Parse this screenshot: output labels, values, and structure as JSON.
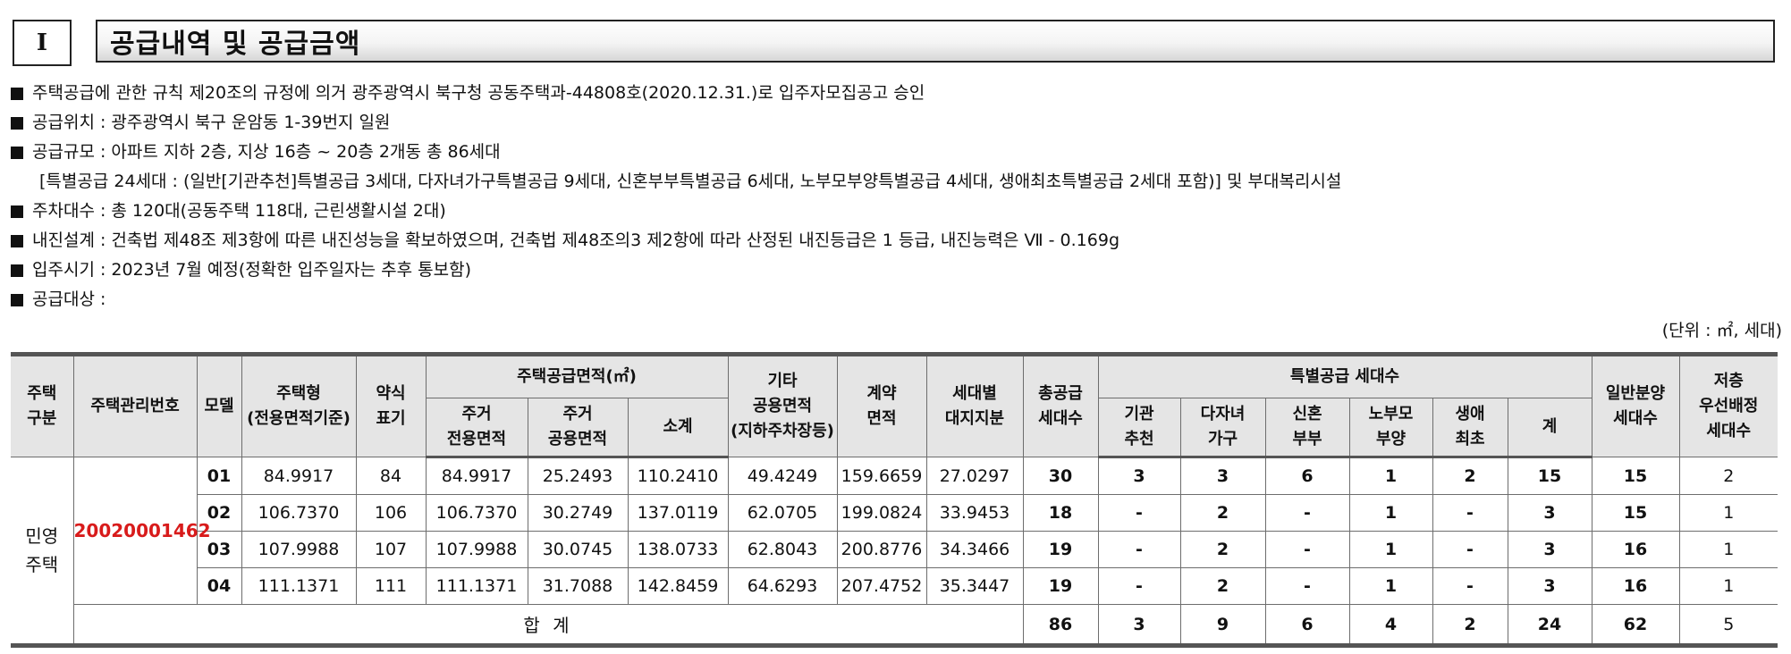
{
  "header": {
    "section_number": "I",
    "title": "공급내역 및 공급금액"
  },
  "bullets": [
    "주택공급에 관한 규칙 제20조의 규정에 의거 광주광역시 북구청 공동주택과-44808호(2020.12.31.)로 입주자모집공고 승인",
    "공급위치 : 광주광역시 북구 운암동 1-39번지 일원",
    "공급규모 : 아파트 지하 2층, 지상 16층 ~ 20층 2개동 총 86세대",
    "주차대수 : 총 120대(공동주택 118대, 근린생활시설 2대)",
    "내진설계 : 건축법 제48조 제3항에 따른 내진성능을 확보하였으며, 건축법 제48조의3 제2항에 따라 산정된 내진등급은 1 등급, 내진능력은 Ⅶ - 0.169g",
    "입주시기 : 2023년 7월 예정(정확한 입주일자는 추후 통보함)",
    "공급대상 :"
  ],
  "bullet_continuation": "[특별공급 24세대 : (일반[기관추천]특별공급 3세대, 다자녀가구특별공급 9세대, 신혼부부특별공급 6세대, 노부모부양특별공급 4세대, 생애최초특별공급 2세대 포함)] 및 부대복리시설",
  "unit_note": "(단위 : ㎡, 세대)",
  "table": {
    "headers": {
      "housing_type_group": "주택\n구분",
      "management_no": "주택관리번호",
      "model": "모델",
      "housing_type": "주택형\n(전용면적기준)",
      "abbrev": "약식\n표기",
      "area_group": "주택공급면적(㎡)",
      "exclusive": "주거\n전용면적",
      "common": "주거\n공용면적",
      "subtotal": "소계",
      "other_common": "기타\n공용면적\n(지하주차장등)",
      "contract": "계약\n면적",
      "land_share": "세대별\n대지지분",
      "total_supply": "총공급\n세대수",
      "special_group": "특별공급 세대수",
      "agency": "기관\n추천",
      "multi_child": "다자녀\n가구",
      "newlywed": "신혼\n부부",
      "elderly": "노부모\n부양",
      "first_time": "생애\n최초",
      "special_sum": "계",
      "general": "일반분양\n세대수",
      "low_floor": "저층\n우선배정\n세대수"
    },
    "housing_type_label": "민영\n주택",
    "management_number": "20020001462",
    "rows": [
      {
        "model": "01",
        "type": "84.9917",
        "abbr": "84",
        "excl": "84.9917",
        "comm": "25.2493",
        "sub": "110.2410",
        "other": "49.4249",
        "contract": "159.6659",
        "land": "27.0297",
        "total": "30",
        "agency": "3",
        "multi": "3",
        "newly": "6",
        "elder": "1",
        "first": "2",
        "ssum": "15",
        "general": "15",
        "low": "2"
      },
      {
        "model": "02",
        "type": "106.7370",
        "abbr": "106",
        "excl": "106.7370",
        "comm": "30.2749",
        "sub": "137.0119",
        "other": "62.0705",
        "contract": "199.0824",
        "land": "33.9453",
        "total": "18",
        "agency": "-",
        "multi": "2",
        "newly": "-",
        "elder": "1",
        "first": "-",
        "ssum": "3",
        "general": "15",
        "low": "1"
      },
      {
        "model": "03",
        "type": "107.9988",
        "abbr": "107",
        "excl": "107.9988",
        "comm": "30.0745",
        "sub": "138.0733",
        "other": "62.8043",
        "contract": "200.8776",
        "land": "34.3466",
        "total": "19",
        "agency": "-",
        "multi": "2",
        "newly": "-",
        "elder": "1",
        "first": "-",
        "ssum": "3",
        "general": "16",
        "low": "1"
      },
      {
        "model": "04",
        "type": "111.1371",
        "abbr": "111",
        "excl": "111.1371",
        "comm": "31.7088",
        "sub": "142.8459",
        "other": "64.6293",
        "contract": "207.4752",
        "land": "35.3447",
        "total": "19",
        "agency": "-",
        "multi": "2",
        "newly": "-",
        "elder": "1",
        "first": "-",
        "ssum": "3",
        "general": "16",
        "low": "1"
      }
    ],
    "sum": {
      "label": "합 계",
      "total": "86",
      "agency": "3",
      "multi": "9",
      "newly": "6",
      "elder": "4",
      "first": "2",
      "ssum": "24",
      "general": "62",
      "low": "5"
    }
  },
  "colors": {
    "management_number": "#d81b1b",
    "header_bg": "#e5e5e5",
    "border": "#6d6d6d",
    "heavy_border": "#555555"
  }
}
